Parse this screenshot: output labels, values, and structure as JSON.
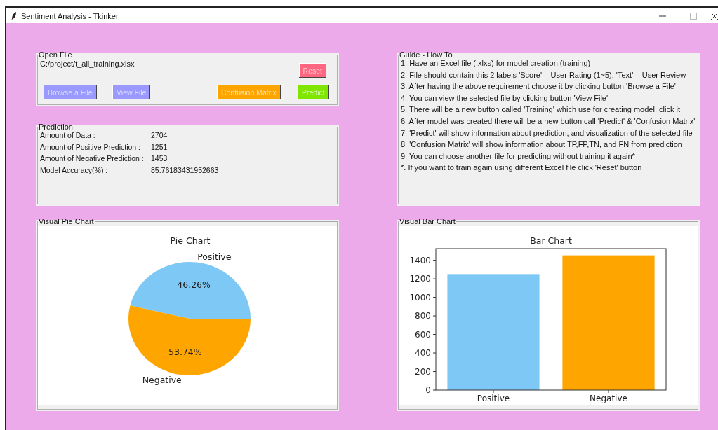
{
  "window": {
    "title": "Sentiment Analysis - Tkinker"
  },
  "open_file": {
    "title": "Open File",
    "path": "C:/project/t_all_training.xlsx",
    "reset_button": {
      "label": "Reset",
      "color": "#ff6680"
    },
    "buttons": [
      {
        "label": "Browse a File",
        "color": "#9999ff"
      },
      {
        "label": "View File",
        "color": "#9999ff"
      },
      {
        "label": "Confusion Matrix",
        "color": "#ffa500"
      },
      {
        "label": "Predict",
        "color": "#80e600"
      }
    ]
  },
  "prediction": {
    "title": "Prediction",
    "rows": [
      {
        "label": "Amount of Data :",
        "value": "2704"
      },
      {
        "label": "Amount of Positive Prediction :",
        "value": "1251"
      },
      {
        "label": "Amount of Negative Prediction :",
        "value": "1453"
      },
      {
        "label": "Model Accuracy(%) :",
        "value": "85.76183431952663"
      }
    ]
  },
  "guide": {
    "title": "Guide - How To",
    "lines": [
      "1. Have an Excel file (.xlxs) for model creation (training)",
      "2. File should contain this 2 labels 'Score' = User Rating (1~5), 'Text' = User Review",
      "3. After having the above requirement choose it by clicking button 'Browse a File'",
      "4. You can view the selected file by clicking button 'View File'",
      "5. There will be a new button called 'Training' which use for creating model, click it",
      "6. After model was created there will be a new button call 'Predict' & 'Confusion Matrix'",
      "7. 'Predict' will show information about prediction, and visualization of the selected file",
      "8. 'Confusion Matrix' will show information about TP,FP,TN, and FN from prediction",
      "9. You can choose another file for predicting without training it again*",
      "*. If you want to train again using different Excel file click 'Reset' button"
    ]
  },
  "pie_panel": {
    "title": "Visual Pie Chart",
    "chart_data": {
      "type": "pie",
      "title": "Pie Chart",
      "categories": [
        "Positive",
        "Negative"
      ],
      "values": [
        46.26,
        53.74
      ],
      "colors": [
        "#7ec8f6",
        "#ffa500"
      ],
      "value_labels": [
        "46.26%",
        "53.74%"
      ]
    }
  },
  "bar_panel": {
    "title": "Visual Bar Chart",
    "chart_data": {
      "type": "bar",
      "title": "Bar Chart",
      "categories": [
        "Positive",
        "Negative"
      ],
      "values": [
        1251,
        1453
      ],
      "colors": [
        "#7ec8f6",
        "#ffa500"
      ],
      "ylim": [
        0,
        1525.65
      ],
      "yticks": [
        0,
        200,
        400,
        600,
        800,
        1000,
        1200,
        1400
      ]
    }
  }
}
